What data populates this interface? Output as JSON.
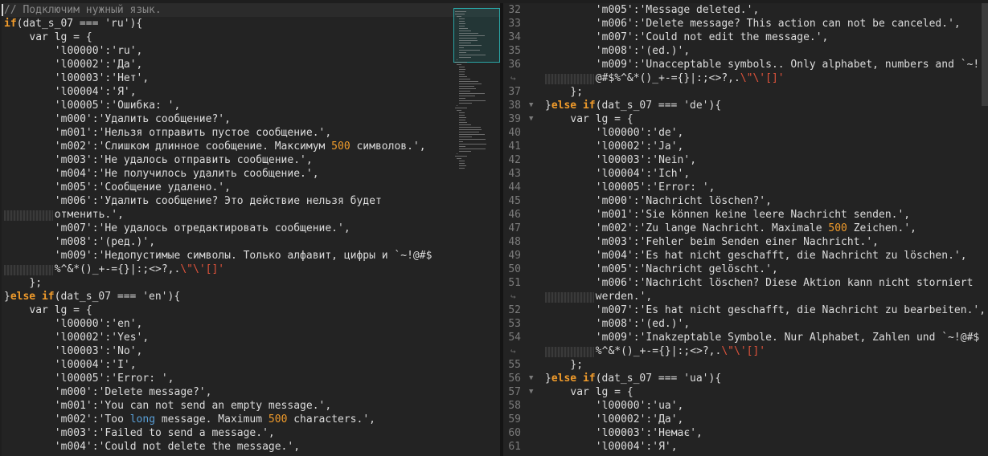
{
  "left_pane": {
    "lines": [
      {
        "indent": 0,
        "current": true,
        "tokens": [
          {
            "t": "// Подключим нужный язык.",
            "c": "comment"
          }
        ]
      },
      {
        "indent": 0,
        "tokens": [
          {
            "t": "if",
            "c": "kw"
          },
          {
            "t": "(dat_s_07 === 'ru'){",
            "c": "plain"
          }
        ]
      },
      {
        "indent": 4,
        "tokens": [
          {
            "t": "var lg = {",
            "c": "plain"
          }
        ]
      },
      {
        "indent": 8,
        "tokens": [
          {
            "t": "'l00000':'ru',",
            "c": "str"
          }
        ]
      },
      {
        "indent": 8,
        "tokens": [
          {
            "t": "'l00002':'Да',",
            "c": "str"
          }
        ]
      },
      {
        "indent": 8,
        "tokens": [
          {
            "t": "'l00003':'Нет',",
            "c": "str"
          }
        ]
      },
      {
        "indent": 8,
        "tokens": [
          {
            "t": "'l00004':'Я',",
            "c": "str"
          }
        ]
      },
      {
        "indent": 8,
        "tokens": [
          {
            "t": "'l00005':'Ошибка: ',",
            "c": "str"
          }
        ]
      },
      {
        "indent": 8,
        "tokens": [
          {
            "t": "'m000':'Удалить сообщение?',",
            "c": "str"
          }
        ]
      },
      {
        "indent": 8,
        "tokens": [
          {
            "t": "'m001':'Нельзя отправить пустое сообщение.',",
            "c": "str"
          }
        ]
      },
      {
        "indent": 8,
        "tokens": [
          {
            "t": "'m002':'Слишком длинное сообщение. Максимум ",
            "c": "str"
          },
          {
            "t": "500",
            "c": "num"
          },
          {
            "t": " символов.',",
            "c": "str"
          }
        ]
      },
      {
        "indent": 8,
        "tokens": [
          {
            "t": "'m003':'Не удалось отправить сообщение.',",
            "c": "str"
          }
        ]
      },
      {
        "indent": 8,
        "tokens": [
          {
            "t": "'m004':'Не получилось удалить сообщение.',",
            "c": "str"
          }
        ]
      },
      {
        "indent": 8,
        "tokens": [
          {
            "t": "'m005':'Сообщение удалено.',",
            "c": "str"
          }
        ]
      },
      {
        "indent": 8,
        "tokens": [
          {
            "t": "'m006':'Удалить сообщение? Это действие нельзя будет",
            "c": "str"
          }
        ]
      },
      {
        "indent": 8,
        "wrap": true,
        "tokens": [
          {
            "t": "отменить.',",
            "c": "str"
          }
        ]
      },
      {
        "indent": 8,
        "tokens": [
          {
            "t": "'m007':'Не удалось отредактировать сообщение.',",
            "c": "str"
          }
        ]
      },
      {
        "indent": 8,
        "tokens": [
          {
            "t": "'m008':'(ред.)',",
            "c": "str"
          }
        ]
      },
      {
        "indent": 8,
        "tokens": [
          {
            "t": "'m009':'Недопустимые символы. Только алфавит, цифры и `~!@#$",
            "c": "str"
          }
        ]
      },
      {
        "indent": 8,
        "wrap": true,
        "tokens": [
          {
            "t": "%^&*()_+-={}|:;<>?,.",
            "c": "str"
          },
          {
            "t": "\\\"\\'[]'",
            "c": "esc"
          }
        ]
      },
      {
        "indent": 4,
        "tokens": [
          {
            "t": "};",
            "c": "plain"
          }
        ]
      },
      {
        "indent": 0,
        "tokens": [
          {
            "t": "}",
            "c": "plain"
          },
          {
            "t": "else if",
            "c": "kw"
          },
          {
            "t": "(dat_s_07 === 'en'){",
            "c": "plain"
          }
        ]
      },
      {
        "indent": 4,
        "tokens": [
          {
            "t": "var lg = {",
            "c": "plain"
          }
        ]
      },
      {
        "indent": 8,
        "tokens": [
          {
            "t": "'l00000':'en',",
            "c": "str"
          }
        ]
      },
      {
        "indent": 8,
        "tokens": [
          {
            "t": "'l00002':'Yes',",
            "c": "str"
          }
        ]
      },
      {
        "indent": 8,
        "tokens": [
          {
            "t": "'l00003':'No',",
            "c": "str"
          }
        ]
      },
      {
        "indent": 8,
        "tokens": [
          {
            "t": "'l00004':'I',",
            "c": "str"
          }
        ]
      },
      {
        "indent": 8,
        "tokens": [
          {
            "t": "'l00005':'Error: ',",
            "c": "str"
          }
        ]
      },
      {
        "indent": 8,
        "tokens": [
          {
            "t": "'m000':'Delete message?',",
            "c": "str"
          }
        ]
      },
      {
        "indent": 8,
        "tokens": [
          {
            "t": "'m001':'You can not send an empty message.',",
            "c": "str"
          }
        ]
      },
      {
        "indent": 8,
        "tokens": [
          {
            "t": "'m002':'Too ",
            "c": "str"
          },
          {
            "t": "long",
            "c": "hl"
          },
          {
            "t": " message. Maximum ",
            "c": "str"
          },
          {
            "t": "500",
            "c": "num"
          },
          {
            "t": " characters.',",
            "c": "str"
          }
        ]
      },
      {
        "indent": 8,
        "tokens": [
          {
            "t": "'m003':'Failed to send a message.',",
            "c": "str"
          }
        ]
      },
      {
        "indent": 8,
        "tokens": [
          {
            "t": "'m004':'Could not delete the message.',",
            "c": "str"
          }
        ]
      }
    ]
  },
  "right_pane": {
    "lines": [
      {
        "num": "32",
        "indent": 8,
        "tokens": [
          {
            "t": "'m005':'Message deleted.',",
            "c": "str"
          }
        ]
      },
      {
        "num": "33",
        "indent": 8,
        "tokens": [
          {
            "t": "'m006':'Delete message? This action can not be canceled.',",
            "c": "str"
          }
        ]
      },
      {
        "num": "34",
        "indent": 8,
        "tokens": [
          {
            "t": "'m007':'Could not edit the message.',",
            "c": "str"
          }
        ]
      },
      {
        "num": "35",
        "indent": 8,
        "tokens": [
          {
            "t": "'m008':'(ed.)',",
            "c": "str"
          }
        ]
      },
      {
        "num": "36",
        "indent": 8,
        "tokens": [
          {
            "t": "'m009':'Unacceptable symbols.. Only alphabet, numbers and `~!",
            "c": "str"
          }
        ]
      },
      {
        "num": "",
        "indent": 8,
        "wrap": true,
        "tokens": [
          {
            "t": "@#$%^&*()_+-={}|:;<>?,.",
            "c": "str"
          },
          {
            "t": "\\\"\\'[]'",
            "c": "esc"
          }
        ]
      },
      {
        "num": "37",
        "indent": 4,
        "tokens": [
          {
            "t": "};",
            "c": "plain"
          }
        ]
      },
      {
        "num": "38",
        "indent": 0,
        "fold": true,
        "tokens": [
          {
            "t": "}",
            "c": "plain"
          },
          {
            "t": "else if",
            "c": "kw"
          },
          {
            "t": "(dat_s_07 === 'de'){",
            "c": "plain"
          }
        ]
      },
      {
        "num": "39",
        "indent": 4,
        "fold": true,
        "tokens": [
          {
            "t": "var lg = {",
            "c": "plain"
          }
        ]
      },
      {
        "num": "40",
        "indent": 8,
        "tokens": [
          {
            "t": "'l00000':'de',",
            "c": "str"
          }
        ]
      },
      {
        "num": "41",
        "indent": 8,
        "tokens": [
          {
            "t": "'l00002':'Ja',",
            "c": "str"
          }
        ]
      },
      {
        "num": "42",
        "indent": 8,
        "tokens": [
          {
            "t": "'l00003':'Nein',",
            "c": "str"
          }
        ]
      },
      {
        "num": "43",
        "indent": 8,
        "tokens": [
          {
            "t": "'l00004':'Ich',",
            "c": "str"
          }
        ]
      },
      {
        "num": "44",
        "indent": 8,
        "tokens": [
          {
            "t": "'l00005':'Error: ',",
            "c": "str"
          }
        ]
      },
      {
        "num": "45",
        "indent": 8,
        "tokens": [
          {
            "t": "'m000':'Nachricht löschen?',",
            "c": "str"
          }
        ]
      },
      {
        "num": "46",
        "indent": 8,
        "tokens": [
          {
            "t": "'m001':'Sie können keine leere Nachricht senden.',",
            "c": "str"
          }
        ]
      },
      {
        "num": "47",
        "indent": 8,
        "tokens": [
          {
            "t": "'m002':'Zu lange Nachricht. Maximale ",
            "c": "str"
          },
          {
            "t": "500",
            "c": "num"
          },
          {
            "t": " Zeichen.',",
            "c": "str"
          }
        ]
      },
      {
        "num": "48",
        "indent": 8,
        "tokens": [
          {
            "t": "'m003':'Fehler beim Senden einer Nachricht.',",
            "c": "str"
          }
        ]
      },
      {
        "num": "49",
        "indent": 8,
        "tokens": [
          {
            "t": "'m004':'Es hat nicht geschafft, die Nachricht zu löschen.',",
            "c": "str"
          }
        ]
      },
      {
        "num": "50",
        "indent": 8,
        "tokens": [
          {
            "t": "'m005':'Nachricht gelöscht.',",
            "c": "str"
          }
        ]
      },
      {
        "num": "51",
        "indent": 8,
        "tokens": [
          {
            "t": "'m006':'Nachricht löschen? Diese Aktion kann nicht storniert",
            "c": "str"
          }
        ]
      },
      {
        "num": "",
        "indent": 8,
        "wrap": true,
        "tokens": [
          {
            "t": "werden.',",
            "c": "str"
          }
        ]
      },
      {
        "num": "52",
        "indent": 8,
        "tokens": [
          {
            "t": "'m007':'Es hat nicht geschafft, die Nachricht zu bearbeiten.',",
            "c": "str"
          }
        ]
      },
      {
        "num": "53",
        "indent": 8,
        "tokens": [
          {
            "t": "'m008':'(ed.)',",
            "c": "str"
          }
        ]
      },
      {
        "num": "54",
        "indent": 8,
        "tokens": [
          {
            "t": "'m009':'Inakzeptable Symbole. Nur Alphabet, Zahlen und `~!@#$",
            "c": "str"
          }
        ]
      },
      {
        "num": "",
        "indent": 8,
        "wrap": true,
        "tokens": [
          {
            "t": "%^&*()_+-={}|:;<>?,.",
            "c": "str"
          },
          {
            "t": "\\\"\\'[]'",
            "c": "esc"
          }
        ]
      },
      {
        "num": "55",
        "indent": 4,
        "tokens": [
          {
            "t": "};",
            "c": "plain"
          }
        ]
      },
      {
        "num": "56",
        "indent": 0,
        "fold": true,
        "tokens": [
          {
            "t": "}",
            "c": "plain"
          },
          {
            "t": "else if",
            "c": "kw"
          },
          {
            "t": "(dat_s_07 === 'ua'){",
            "c": "plain"
          }
        ]
      },
      {
        "num": "57",
        "indent": 4,
        "fold": true,
        "tokens": [
          {
            "t": "var lg = {",
            "c": "plain"
          }
        ]
      },
      {
        "num": "58",
        "indent": 8,
        "tokens": [
          {
            "t": "'l00000':'ua',",
            "c": "str"
          }
        ]
      },
      {
        "num": "59",
        "indent": 8,
        "tokens": [
          {
            "t": "'l00002':'Да',",
            "c": "str"
          }
        ]
      },
      {
        "num": "60",
        "indent": 8,
        "tokens": [
          {
            "t": "'l00003':'Немає',",
            "c": "str"
          }
        ]
      },
      {
        "num": "61",
        "indent": 8,
        "tokens": [
          {
            "t": "'l00004':'Я',",
            "c": "str"
          }
        ]
      }
    ]
  },
  "icons": {
    "fold": "fold-triangle-icon",
    "wrap": "wrap-arrow-icon"
  },
  "colors": {
    "keyword": "#f09b2b",
    "number": "#f09b2b",
    "highlight": "#5aa0d8",
    "escape": "#e0533b",
    "comment": "#8a8a8a",
    "text": "#dcdcdc",
    "minimap_view": "#2aa6a6"
  }
}
